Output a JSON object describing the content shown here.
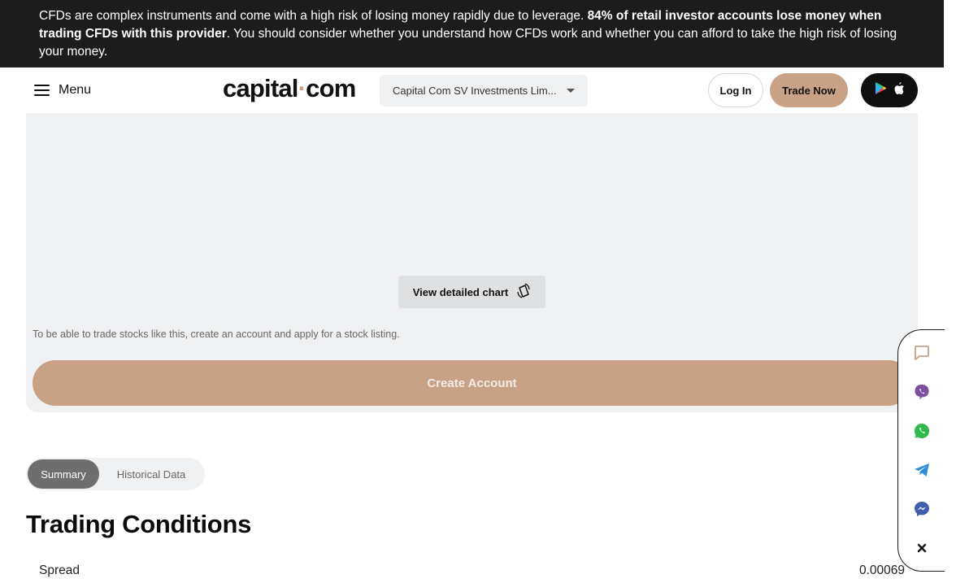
{
  "risk_banner": {
    "text_before": "CFDs are complex instruments and come with a high risk of losing money rapidly due to leverage. ",
    "text_bold": "84% of retail investor accounts lose money when trading CFDs with this provider",
    "text_after": ". You should consider whether you understand how CFDs work and whether you can afford to take the high risk of losing your money."
  },
  "header": {
    "menu_label": "Menu",
    "logo_left": "capital",
    "logo_dot": "·",
    "logo_right": "com",
    "entity_selected": "Capital Com SV Investments Lim...",
    "login_label": "Log In",
    "trade_label": "Trade Now",
    "store_icons": [
      "google-play-icon",
      "apple-icon"
    ]
  },
  "chart": {
    "view_button_label": "View detailed chart",
    "note": "To be able to trade stocks like this, create an account and apply for a stock listing.",
    "create_account_label": "Create Account"
  },
  "tabs": [
    {
      "label": "Summary",
      "active": true
    },
    {
      "label": "Historical Data",
      "active": false
    }
  ],
  "trading_conditions": {
    "title": "Trading Conditions",
    "rows": [
      {
        "label": "Spread",
        "value": "0.00069"
      }
    ]
  },
  "social": {
    "items": [
      "chat-icon",
      "viber-icon",
      "whatsapp-icon",
      "telegram-icon",
      "messenger-icon",
      "close-icon"
    ]
  },
  "colors": {
    "brand_accent": "#c9a185",
    "banner_bg": "#1c1c1c",
    "panel_bg": "#f0f1f3",
    "viber": "#7d4f9e",
    "whatsapp": "#2fb84b",
    "telegram": "#2f8ed6",
    "messenger": "#3f5fae"
  }
}
